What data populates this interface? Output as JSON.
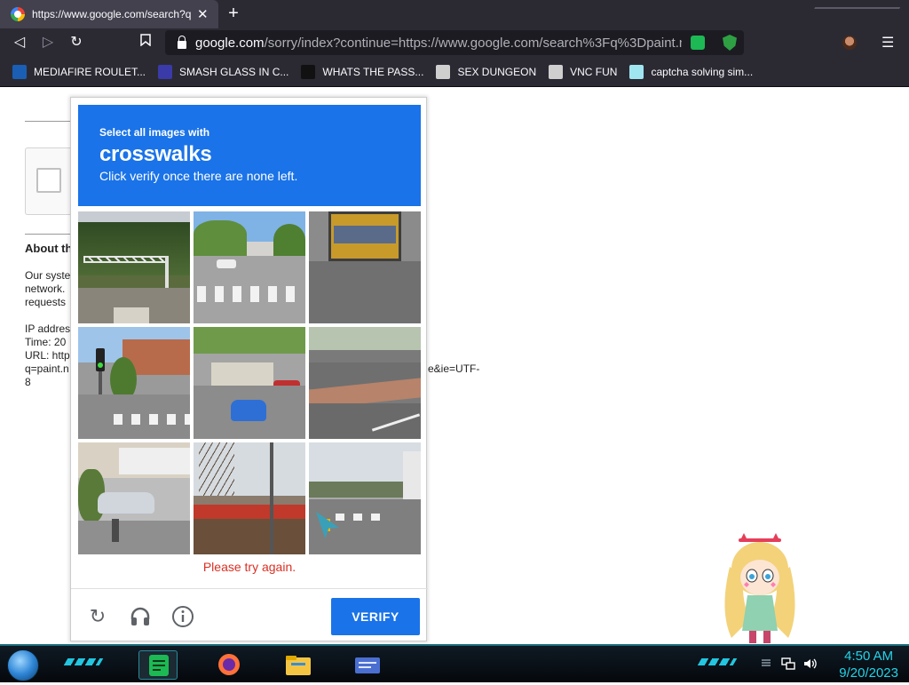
{
  "browser": {
    "tab_title": "https://www.google.com/search?q",
    "tab_close": "✕",
    "new_tab": "+",
    "url_host": "google.com",
    "url_rest": "/sorry/index?continue=https://www.google.com/search%3Fq%3Dpaint.ne...",
    "nav_back": "◁",
    "nav_forward": "▷",
    "nav_reload": "↻",
    "bookmark_star": "🔖",
    "menu": "☰"
  },
  "bookmarks": [
    {
      "label": "MEDIAFIRE ROULET...",
      "icon": "mediafire-icon",
      "color": "#1a5fb4"
    },
    {
      "label": "SMASH GLASS IN C...",
      "icon": "chevron-icon",
      "color": "#3a3aa8"
    },
    {
      "label": "WHATS THE PASS...",
      "icon": "box-icon",
      "color": "#111111"
    },
    {
      "label": "SEX DUNGEON",
      "icon": "gear-icon",
      "color": "#cfcfcf"
    },
    {
      "label": "VNC FUN",
      "icon": "gear-icon",
      "color": "#cfcfcf"
    },
    {
      "label": "captcha solving sim...",
      "icon": "a-icon",
      "color": "#a0e6f0"
    }
  ],
  "background_page": {
    "about": "About th",
    "lines": [
      "Our syste",
      "network.",
      "requests",
      "",
      "IP addres",
      "Time: 20",
      "URL: http",
      "q=paint.n",
      "8"
    ],
    "right_fragment": "e&ie=UTF-"
  },
  "captcha": {
    "instruction_small": "Select all images with",
    "target": "crosswalks",
    "instruction_sub": "Click verify once there are none left.",
    "error": "Please try again.",
    "verify_label": "VERIFY",
    "reload_icon": "↻",
    "audio_icon": "🎧",
    "info_icon": "ⓘ",
    "tiles": [
      {
        "scene": "trees-gantry"
      },
      {
        "scene": "crosswalk-street"
      },
      {
        "scene": "truck-road"
      },
      {
        "scene": "traffic-light-crosswalk"
      },
      {
        "scene": "blue-car-street"
      },
      {
        "scene": "brick-sidewalk"
      },
      {
        "scene": "parked-car"
      },
      {
        "scene": "storefront"
      },
      {
        "scene": "road-crosswalk-distant"
      }
    ]
  },
  "taskbar": {
    "time": "4:50 AM",
    "date": "9/20/2023",
    "accent": "#22d3e8"
  }
}
